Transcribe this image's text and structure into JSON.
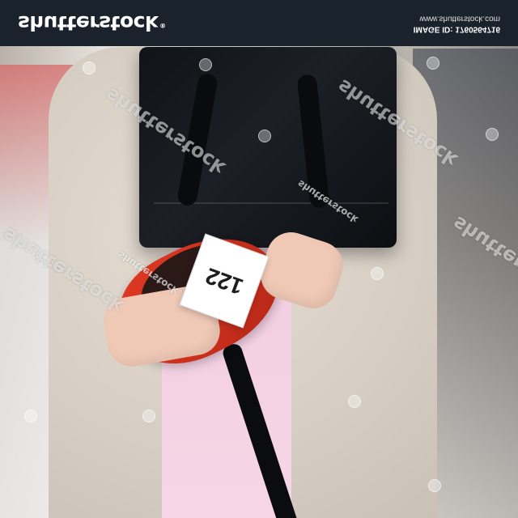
{
  "header": {
    "brand": "shutterstock",
    "brand_mark": "®",
    "url": "www.shutterstock.com",
    "image_id": "IMAGE ID: 1760564716"
  },
  "watermark": {
    "text": "shutterstock",
    "small_text": "shutterstock"
  },
  "tag": {
    "price": "122"
  },
  "colors": {
    "topbar": "#1a222c",
    "shoe": "#d6351f",
    "bag": "#14181d",
    "jacket": "#ddd3c8",
    "shirt": "#f4d2e2"
  }
}
